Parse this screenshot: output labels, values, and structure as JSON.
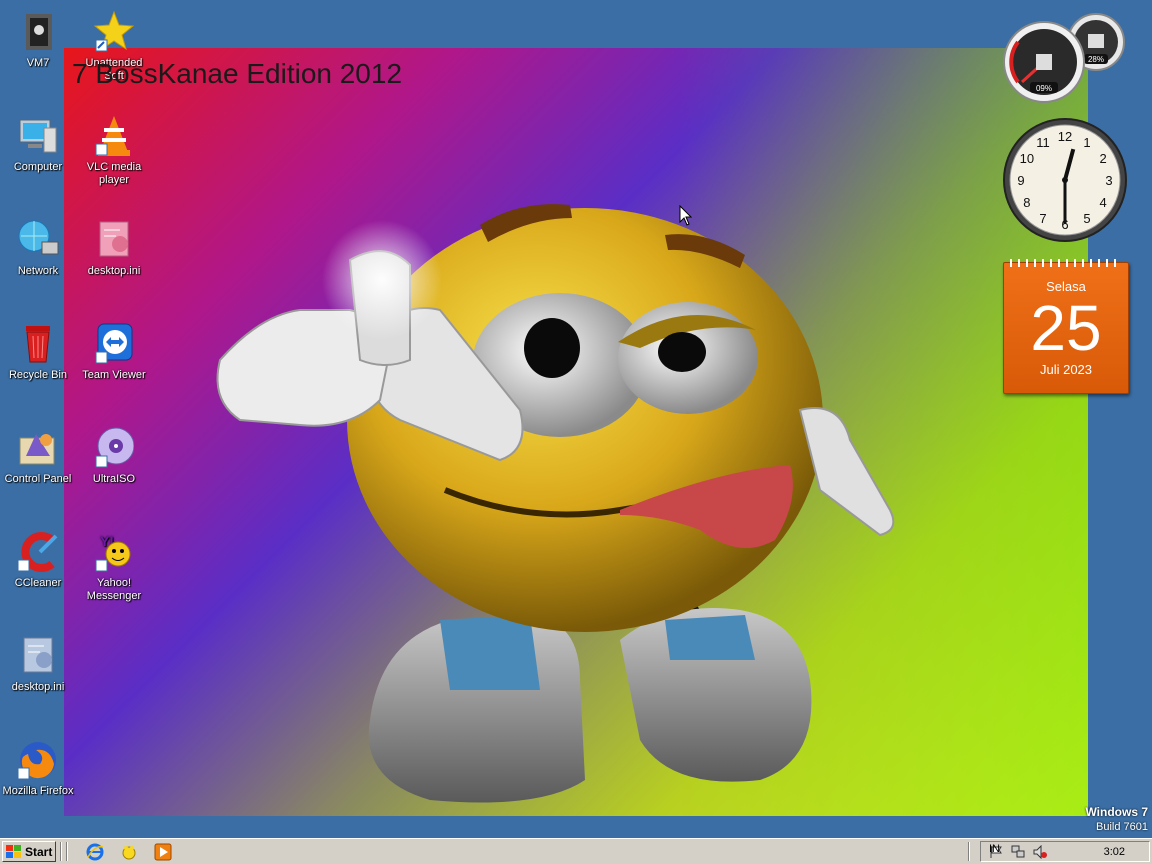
{
  "wallpaper": {
    "title": "7 BossKanae Edition 2012"
  },
  "brand": {
    "line1": "Windows 7",
    "line2": "Build 7601"
  },
  "icons": [
    {
      "label": "VM7",
      "icon": "folder-shortcut-icon"
    },
    {
      "label": "Unattended Soft",
      "icon": "star-icon"
    },
    {
      "label": "Computer",
      "icon": "computer-icon"
    },
    {
      "label": "VLC media player",
      "icon": "vlc-icon"
    },
    {
      "label": "Network",
      "icon": "network-icon"
    },
    {
      "label": "desktop.ini",
      "icon": "settings-file-icon"
    },
    {
      "label": "Recycle Bin",
      "icon": "recycle-bin-icon"
    },
    {
      "label": "Team Viewer",
      "icon": "teamviewer-icon"
    },
    {
      "label": "Control Panel",
      "icon": "control-panel-icon"
    },
    {
      "label": "UltraISO",
      "icon": "disc-icon"
    },
    {
      "label": "CCleaner",
      "icon": "ccleaner-icon"
    },
    {
      "label": "Yahoo! Messenger",
      "icon": "yahoo-messenger-icon"
    },
    {
      "label": "desktop.ini",
      "icon": "settings-file-icon"
    },
    {
      "label": "Mozilla Firefox",
      "icon": "firefox-icon"
    }
  ],
  "gadgets": {
    "cpu": {
      "cpu_percent": "09%",
      "ram_percent": "28%"
    },
    "clock": {
      "hour": 12,
      "minute": 30,
      "numerals": [
        "12",
        "1",
        "2",
        "3",
        "4",
        "5",
        "6",
        "7",
        "8",
        "9",
        "10",
        "11"
      ]
    },
    "calendar": {
      "day_name": "Selasa",
      "day": "25",
      "month_year": "Juli 2023"
    }
  },
  "taskbar": {
    "start_label": "Start",
    "language": "IN",
    "time": "3:02",
    "quick_launch": [
      "internet-explorer-icon",
      "show-desktop-icon",
      "media-player-icon"
    ],
    "tray": [
      "action-center-flag-icon",
      "network-tray-icon",
      "volume-muted-icon"
    ]
  },
  "colors": {
    "desktop_bg": "#3a6ea5",
    "calendar_orange": "#e86410",
    "taskbar_bg": "#d4d0c8"
  }
}
